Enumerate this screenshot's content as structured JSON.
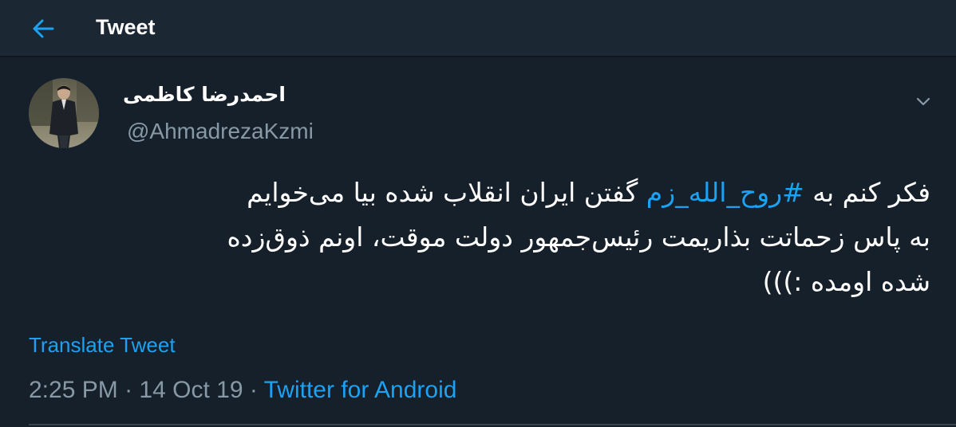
{
  "header": {
    "title": "Tweet",
    "back_icon": "arrow-left-icon"
  },
  "colors": {
    "background": "#15202b",
    "header_bg": "#1b2733",
    "accent": "#1da1f2",
    "secondary_text": "#8899a6"
  },
  "tweet": {
    "author": {
      "display_name": "احمدرضا کاظمی",
      "handle": "@AhmadrezaKzmi",
      "avatar_icon": "user-avatar"
    },
    "menu_icon": "chevron-down-icon",
    "text": {
      "line1_before": "فکر کنم به ",
      "hashtag": "#روح_الله_زم",
      "line1_after": " گفتن ایران انقلاب شده بیا می‌خوایم",
      "line2": "به پاس زحماتت بذاریمت رئیس‌جمهور دولت موقت، اونم ذوق‌زده",
      "line3": "شده اومده :)))"
    },
    "translate_label": "Translate Tweet",
    "time": "2:25 PM",
    "date": "14 Oct 19",
    "separator": "·",
    "source": "Twitter for Android"
  }
}
